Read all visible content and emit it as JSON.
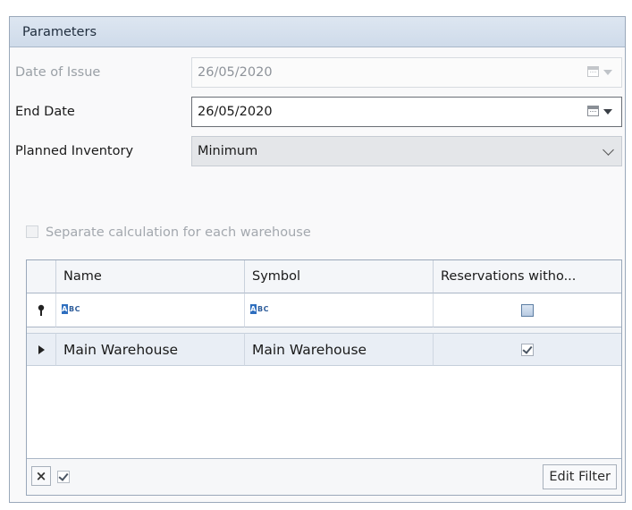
{
  "panel": {
    "title": "Parameters"
  },
  "date_of_issue": {
    "label": "Date of Issue",
    "value": "26/05/2020",
    "enabled": false
  },
  "end_date": {
    "label": "End Date",
    "value": "26/05/2020"
  },
  "planned_inventory": {
    "label": "Planned Inventory",
    "value": "Minimum"
  },
  "separate_calc": {
    "label": "Separate calculation for each warehouse",
    "checked": false,
    "enabled": false
  },
  "grid": {
    "columns": [
      "Name",
      "Symbol",
      "Reservations witho..."
    ],
    "filter_icons": [
      "abc-text-filter-icon",
      "abc-text-filter-icon"
    ],
    "filter_icon_text": {
      "a": "A",
      "rest": "BC"
    },
    "rows": [
      {
        "name": "Main Warehouse",
        "symbol": "Main Warehouse",
        "reservations": true
      }
    ]
  },
  "footer": {
    "clear_symbol": "×",
    "enable_filter_checked": true,
    "edit_filter_label": "Edit Filter"
  },
  "colors": {
    "header_bg": "#d6e0ec",
    "row_highlight": "#e9eef5",
    "border": "#9aa8ba"
  }
}
